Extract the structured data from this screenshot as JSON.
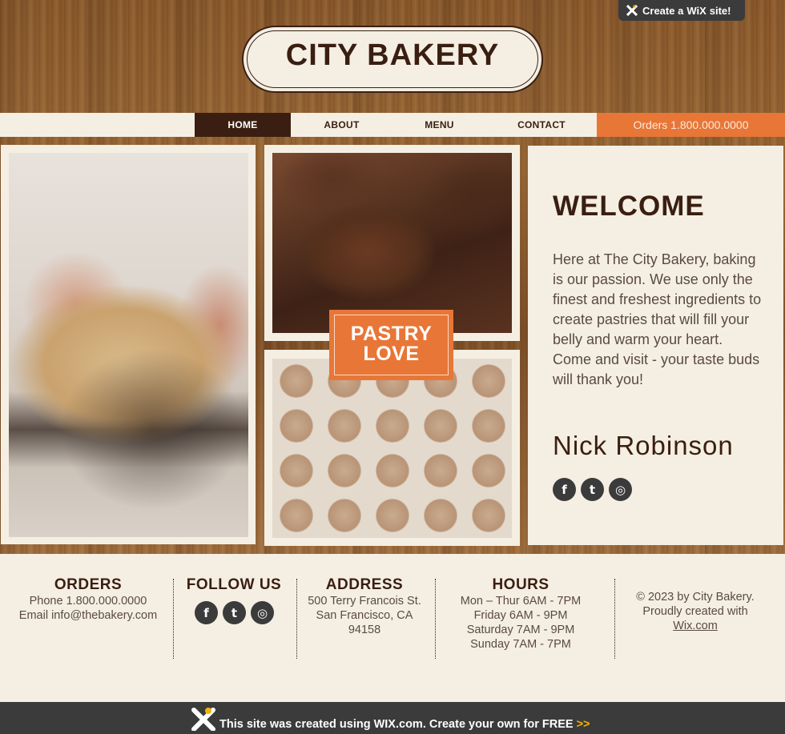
{
  "wix_badge": {
    "prefix": "Create a",
    "brand": "WiX",
    "suffix": "site!"
  },
  "logo": {
    "text": "CITY BAKERY"
  },
  "nav": {
    "items": [
      {
        "label": "HOME",
        "active": true
      },
      {
        "label": "ABOUT",
        "active": false
      },
      {
        "label": "MENU",
        "active": false
      },
      {
        "label": "CONTACT",
        "active": false
      }
    ],
    "orders": "Orders 1.800.000.0000"
  },
  "pastry_badge": {
    "line1": "PASTRY",
    "line2": "LOVE"
  },
  "welcome": {
    "title": "WELCOME",
    "body": "Here at The City Bakery, baking is our passion. We use only the finest and freshest ingredients to create pastries that will fill your belly and warm your heart. Come and visit - your taste buds will thank you!",
    "signature": "Nick  Robinson",
    "social": [
      {
        "icon": "facebook-icon",
        "glyph": "f"
      },
      {
        "icon": "twitter-icon",
        "glyph": "t"
      },
      {
        "icon": "instagram-icon",
        "glyph": "◎"
      }
    ]
  },
  "footer": {
    "orders": {
      "title": "ORDERS",
      "phone": "Phone 1.800.000.0000",
      "email": "Email info@thebakery.com"
    },
    "follow": {
      "title": "FOLLOW US"
    },
    "address": {
      "title": "ADDRESS",
      "line1": "500 Terry Francois St.",
      "line2": "San Francisco, CA",
      "line3": "94158"
    },
    "hours": {
      "title": "HOURS",
      "line1": "Mon – Thur  6AM - 7PM",
      "line2": "Friday  6AM - 9PM",
      "line3": "Saturday  7AM - 9PM",
      "line4": "Sunday  7AM - 7PM"
    },
    "copyright": {
      "line1": "© 2023 by City Bakery.",
      "line2": "Proudly created with",
      "link": "Wix.com"
    }
  },
  "bottom_bar": {
    "text": "This site was created using WIX.com. Create your own for FREE",
    "arrows": ">>"
  },
  "colors": {
    "accent": "#e87637",
    "dark_brown": "#3a1e12",
    "cream": "#f5efe3",
    "bar": "#3b3b3b"
  }
}
